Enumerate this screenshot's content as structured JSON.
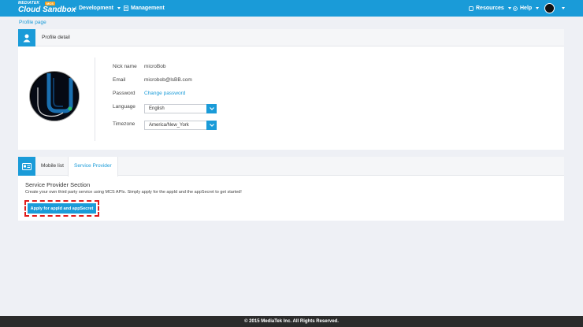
{
  "brand": {
    "top_line": "MEDIATEK",
    "badge": "MCS",
    "name": "Cloud Sandbox"
  },
  "nav": {
    "development": "Development",
    "management": "Management",
    "resources": "Resources",
    "help": "Help"
  },
  "breadcrumb": "Profile page",
  "profile": {
    "title": "Profile detail",
    "nickname_label": "Nick name",
    "nickname_value": "microBob",
    "email_label": "Email",
    "email_value": "microbob@lsBB.com",
    "password_label": "Password",
    "password_link": "Change password",
    "language_label": "Language",
    "language_value": "English",
    "timezone_label": "Timezone",
    "timezone_value": "America/New_York"
  },
  "tabs": {
    "mobile": "Mobile list",
    "service": "Service Provider"
  },
  "service": {
    "title": "Service Provider Section",
    "description": "Create your own third party service using MCS APIs. Simply apply for the appId and the appSecret to get started!",
    "apply_button": "Apply for appId and appSecret"
  },
  "footer": "© 2015 MediaTek Inc. All Rights Reserved.",
  "colors": {
    "accent": "#1a9bd8",
    "highlight": "#e01b1b",
    "footer": "#2b2b2b"
  }
}
